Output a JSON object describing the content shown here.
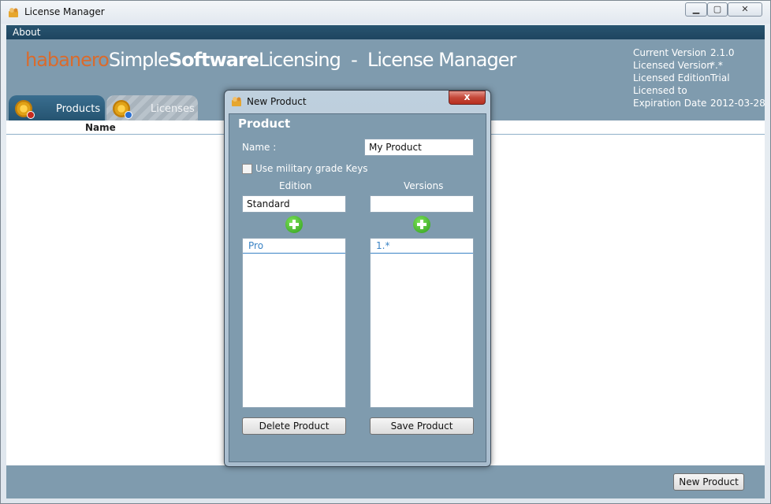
{
  "window": {
    "title": "License Manager"
  },
  "menu": {
    "about": "About"
  },
  "brand": {
    "part1": "habanero",
    "part2": "Simple",
    "part3": "Software",
    "part4": "Licensing",
    "sep": "-",
    "part5": "License Manager"
  },
  "info": [
    {
      "key": "Current Version",
      "value": "2.1.0"
    },
    {
      "key": "Licensed Version",
      "value": "*.*"
    },
    {
      "key": "Licensed Edition",
      "value": "Trial"
    },
    {
      "key": "Licensed to",
      "value": ""
    },
    {
      "key": "Expiration Date",
      "value": "2012-03-28"
    }
  ],
  "tabs": {
    "products": "Products",
    "licenses": "Licenses"
  },
  "table": {
    "col_name": "Name"
  },
  "footer": {
    "new_product": "New Product"
  },
  "dialog": {
    "title": "New Product",
    "close": "x",
    "heading": "Product",
    "name_label": "Name :",
    "name_value": "My Product",
    "military_label": "Use military grade Keys",
    "edition_label": "Edition",
    "versions_label": "Versions",
    "edition_value": "Standard",
    "versions_value": "",
    "editions": [
      "Pro"
    ],
    "versions": [
      "1.*"
    ],
    "delete": "Delete Product",
    "save": "Save Product"
  },
  "colors": {
    "accent": "#24526f",
    "brand_orange": "#d96b2d",
    "panel": "#7f9bae"
  }
}
